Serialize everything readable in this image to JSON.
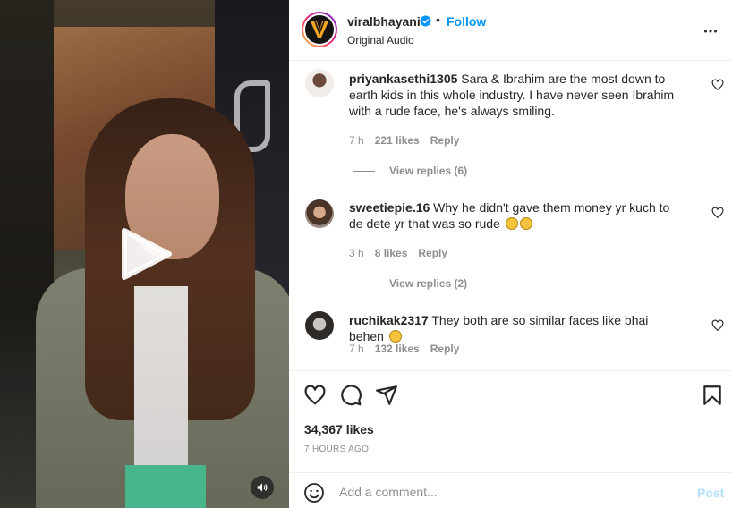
{
  "post": {
    "username": "viralbhayani",
    "follow_label": "Follow",
    "separator": "•",
    "audio": "Original Audio"
  },
  "comments": [
    {
      "user": "priyankasethi1305",
      "text": "Sara & Ibrahim are the most down to earth kids in this whole industry. I have never seen Ibrahim with a rude face, he's always smiling.",
      "time": "7 h",
      "likes": "221 likes",
      "reply": "Reply",
      "view_replies": "View replies (6)"
    },
    {
      "user": "sweetiepie.16",
      "text": "Why he didn't gave them money yr kuch to de dete yr that was so rude",
      "emoji": "persevering-face-emoji",
      "time": "3 h",
      "likes": "8 likes",
      "reply": "Reply",
      "view_replies": "View replies (2)"
    },
    {
      "user": "ruchikak2317",
      "text": "They both are so similar faces like bhai behen",
      "emoji": "smiling-face-emoji",
      "time": "7 h",
      "likes": "132 likes",
      "reply": "Reply"
    }
  ],
  "actions": {
    "likes": "34,367 likes",
    "posted": "7 HOURS AGO"
  },
  "composer": {
    "placeholder": "Add a comment...",
    "post_label": "Post"
  },
  "colors": {
    "accent": "#0095f6",
    "post_disabled": "#b2dffc",
    "muted": "#8e8e8e",
    "text": "#262626"
  }
}
